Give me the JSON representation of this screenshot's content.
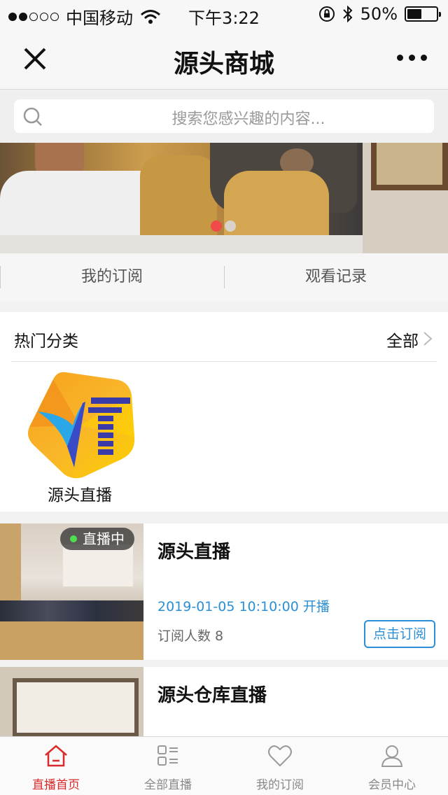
{
  "status_bar": {
    "carrier": "中国移动",
    "time": "下午3:22",
    "battery": "50%",
    "battery_level": 0.5,
    "signal_bars_filled": 2,
    "signal_bars_total": 5
  },
  "navbar": {
    "title": "源头商城"
  },
  "search": {
    "placeholder": "搜索您感兴趣的内容..."
  },
  "banner": {
    "active_index": 0,
    "total": 2
  },
  "subtabs": [
    {
      "label": "我的订阅"
    },
    {
      "label": "观看记录"
    }
  ],
  "hot_category": {
    "title": "热门分类",
    "all_label": "全部",
    "items": [
      {
        "name": "源头直播"
      }
    ]
  },
  "live_list": [
    {
      "badge": "直播中",
      "title": "源头直播",
      "start_time": "2019-01-05 10:10:00 开播",
      "subscribers": "订阅人数 8",
      "button": "点击订阅"
    },
    {
      "title": "源头仓库直播"
    }
  ],
  "tabbar": [
    {
      "label": "直播首页",
      "icon": "home-icon",
      "active": true
    },
    {
      "label": "全部直播",
      "icon": "grid-list-icon",
      "active": false
    },
    {
      "label": "我的订阅",
      "icon": "heart-icon",
      "active": false
    },
    {
      "label": "会员中心",
      "icon": "user-icon",
      "active": false
    }
  ],
  "colors": {
    "accent_red": "#d92b2b",
    "link_blue": "#2a8fd6",
    "live_green": "#4ee04e"
  }
}
